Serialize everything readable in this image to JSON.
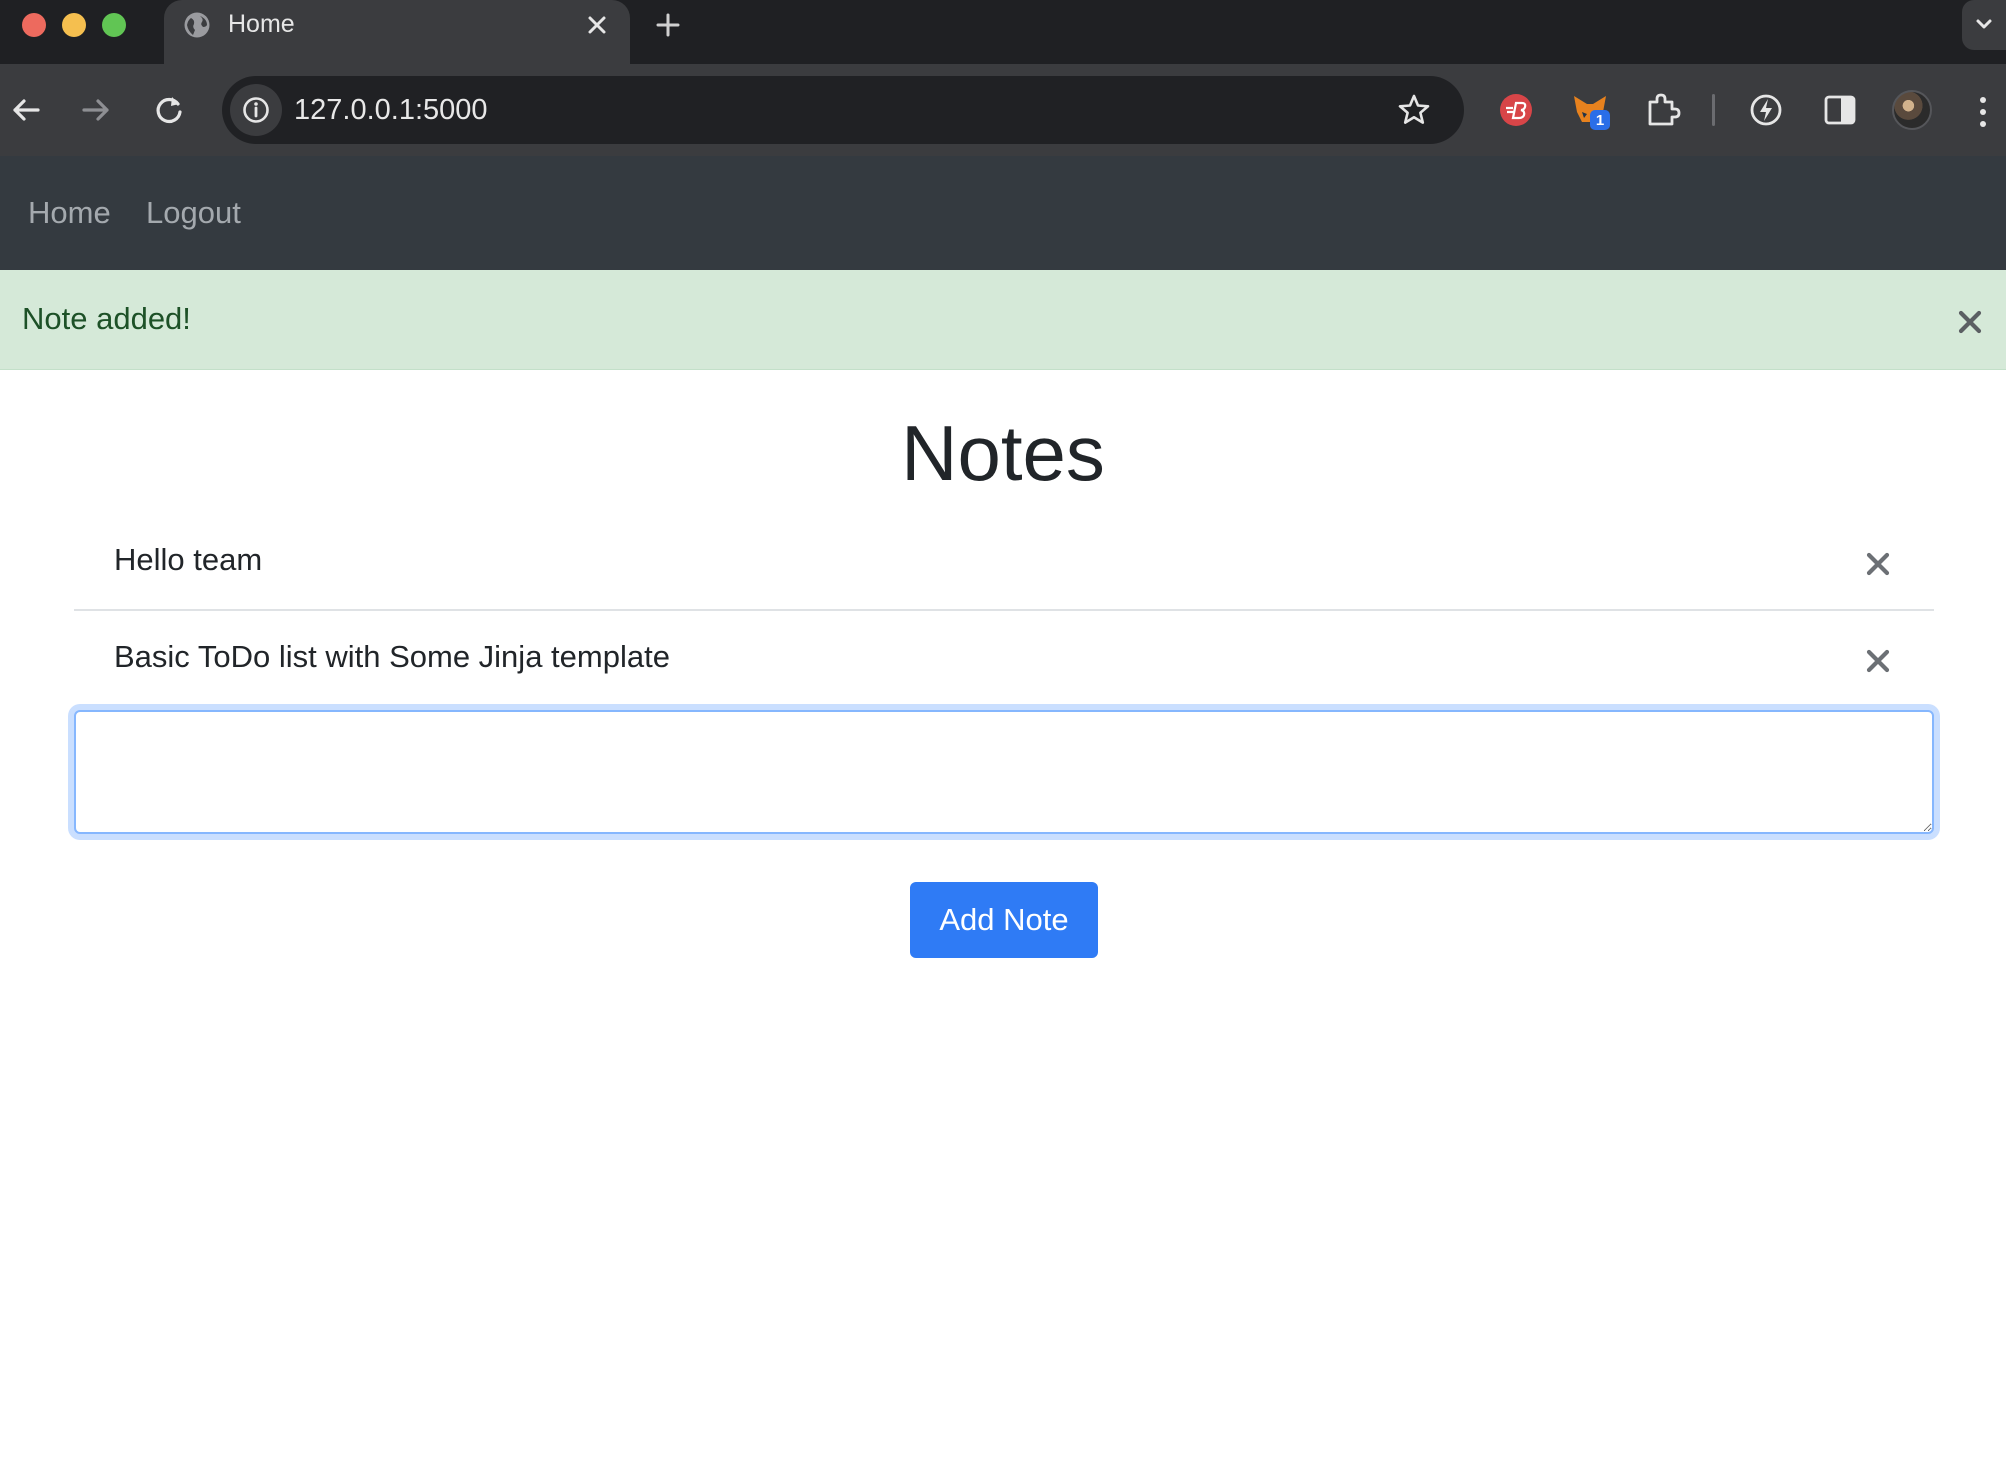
{
  "browser": {
    "tab_title": "Home",
    "url": "127.0.0.1:5000",
    "extension_badge": "1"
  },
  "navbar": {
    "home_label": "Home",
    "logout_label": "Logout"
  },
  "alert": {
    "message": "Note added!",
    "color": "#d5e9d8"
  },
  "main": {
    "title": "Notes",
    "notes": [
      {
        "text": "Hello team"
      },
      {
        "text": "Basic ToDo list with Some Jinja template"
      }
    ],
    "note_input": {
      "value": "",
      "placeholder": ""
    },
    "add_button_label": "Add Note"
  },
  "colors": {
    "navbar_bg": "#343a40",
    "primary": "#2f7bf5",
    "alert_text": "#1d5127"
  },
  "icons": {
    "close": "x-icon",
    "globe": "globe-icon",
    "star": "star-icon"
  }
}
